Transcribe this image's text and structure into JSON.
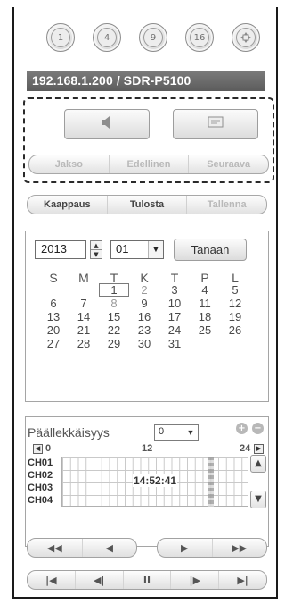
{
  "channels": [
    "1",
    "4",
    "9",
    "16"
  ],
  "channel_extra_icon": "fullscreen-icon",
  "device_address": "192.168.1.200 / SDR-P5100",
  "audio_button_icon": "speaker-icon",
  "display_button_icon": "monitor-icon",
  "nav": {
    "period": "Jakso",
    "previous": "Edellinen",
    "next": "Seuraava"
  },
  "actions": {
    "capture": "Kaappaus",
    "print": "Tulosta",
    "save": "Tallenna"
  },
  "calendar": {
    "year": "2013",
    "month": "01",
    "today_label": "Tanaan",
    "weekdays": [
      "S",
      "M",
      "T",
      "K",
      "T",
      "P",
      "L"
    ],
    "weeks": [
      [
        "",
        "",
        "1",
        "2",
        "3",
        "4",
        "5"
      ],
      [
        "6",
        "7",
        "8",
        "9",
        "10",
        "11",
        "12"
      ],
      [
        "13",
        "14",
        "15",
        "16",
        "17",
        "18",
        "19"
      ],
      [
        "20",
        "21",
        "22",
        "23",
        "24",
        "25",
        "26"
      ],
      [
        "27",
        "28",
        "29",
        "30",
        "31",
        "",
        ""
      ]
    ]
  },
  "timeline": {
    "overlap_label": "Päällekkäisyys",
    "overlap_value": "0",
    "scale": [
      "0",
      "12",
      "24"
    ],
    "channels": [
      "CH01",
      "CH02",
      "CH03",
      "CH04"
    ],
    "time": "14:52:41"
  },
  "playback": {
    "fast_rewind": "◀◀",
    "rewind": "◀",
    "play": "▶",
    "fast_forward": "▶▶",
    "first": "|◀",
    "step_back": "◀|",
    "pause": "II",
    "step_forward": "|▶",
    "last": "▶|"
  }
}
